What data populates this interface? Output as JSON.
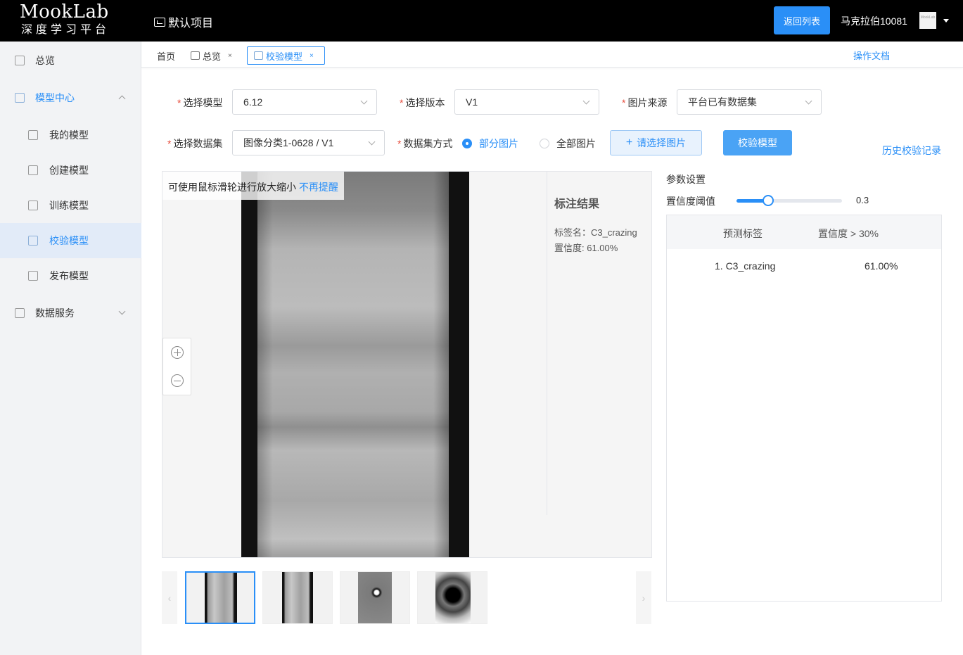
{
  "header": {
    "logo_title": "MookLab",
    "logo_subtitle": "深度学习平台",
    "project_name": "默认项目",
    "back_button": "返回列表",
    "username": "马克拉伯10081",
    "avatar_text": "MookLab"
  },
  "sidebar": {
    "items": [
      {
        "label": "总览",
        "icon": "overview-icon"
      },
      {
        "label": "模型中心",
        "icon": "cube-icon"
      },
      {
        "label": "我的模型",
        "icon": "cube-icon"
      },
      {
        "label": "创建模型",
        "icon": "cube-plus-icon"
      },
      {
        "label": "训练模型",
        "icon": "cube-icon"
      },
      {
        "label": "校验模型",
        "icon": "cube-check-icon"
      },
      {
        "label": "发布模型",
        "icon": "cube-icon"
      },
      {
        "label": "数据服务",
        "icon": "database-icon"
      }
    ]
  },
  "tabs": {
    "home": "首页",
    "overview": "总览",
    "active": "校验模型",
    "close": "×",
    "doc_link": "操作文档"
  },
  "form": {
    "model_label": "选择模型",
    "model_value": "6.12",
    "version_label": "选择版本",
    "version_value": "V1",
    "source_label": "图片来源",
    "source_value": "平台已有数据集",
    "dataset_label": "选择数据集",
    "dataset_value": "图像分类1-0628 / V1",
    "mode_label": "数据集方式",
    "mode_partial": "部分图片",
    "mode_all": "全部图片",
    "select_images_button": "请选择图片",
    "verify_button": "校验模型",
    "history_link": "历史校验记录",
    "required_mark": "*"
  },
  "viewer": {
    "tip_text": "可使用鼠标滑轮进行放大缩小",
    "tip_link": "不再提醒",
    "annotation_title": "标注结果",
    "annotation_label": "标签名：C3_crazing",
    "annotation_confidence": "置信度: 61.00%"
  },
  "params": {
    "title": "参数设置",
    "confidence_label": "置信度阈值",
    "confidence_value": "0.3",
    "confidence_level": 0.3,
    "table_head_label": "预测标签",
    "table_head_conf": "置信度 > 30%",
    "rows": [
      {
        "label": "1. C3_crazing",
        "confidence": "61.00%"
      }
    ]
  },
  "colors": {
    "accent": "#2a8ff7",
    "required": "#e74c3c",
    "header_bg": "#000000",
    "sidebar_bg": "#f2f3f5"
  }
}
